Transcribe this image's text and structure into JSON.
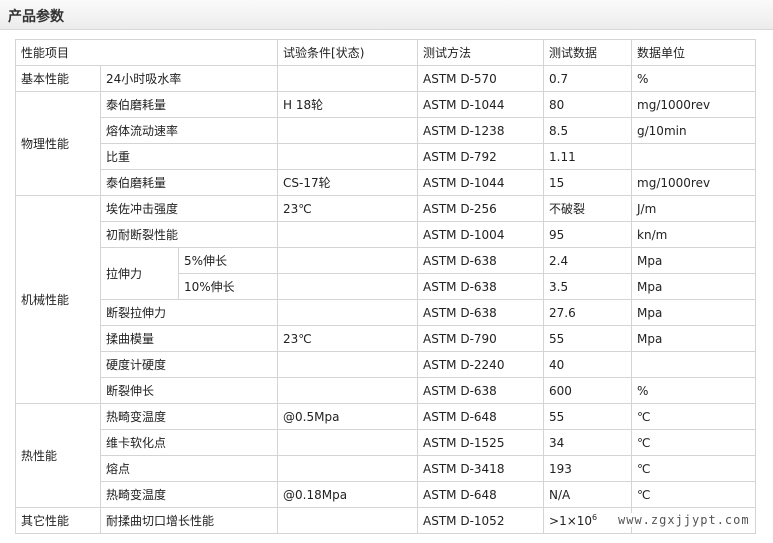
{
  "header": {
    "title": "产品参数"
  },
  "table": {
    "columns": [
      "性能项目",
      "试验条件[状态)",
      "测试方法",
      "测试数据",
      "数据单位"
    ],
    "rows": [
      {
        "category": "基本性能",
        "item": "24小时吸水率",
        "condition": "",
        "method": "ASTM D-570",
        "value": "0.7",
        "unit": "%"
      },
      {
        "category": "物理性能",
        "item": "泰伯磨耗量",
        "condition": "H 18轮",
        "method": "ASTM D-1044",
        "value": "80",
        "unit": "mg/1000rev"
      },
      {
        "category": "物理性能",
        "item": "熔体流动速率",
        "condition": "",
        "method": "ASTM D-1238",
        "value": "8.5",
        "unit": "g/10min"
      },
      {
        "category": "物理性能",
        "item": "比重",
        "condition": "",
        "method": "ASTM D-792",
        "value": "1.11",
        "unit": ""
      },
      {
        "category": "物理性能",
        "item": "泰伯磨耗量",
        "condition": "CS-17轮",
        "method": "ASTM D-1044",
        "value": "15",
        "unit": "mg/1000rev"
      },
      {
        "category": "机械性能",
        "item": "埃佐冲击强度",
        "condition": "23℃",
        "method": "ASTM D-256",
        "value": "不破裂",
        "unit": "J/m"
      },
      {
        "category": "机械性能",
        "item": "初耐断裂性能",
        "condition": "",
        "method": "ASTM D-1004",
        "value": "95",
        "unit": "kn/m"
      },
      {
        "category": "机械性能",
        "item": "拉伸力",
        "sub": "5%伸长",
        "condition": "",
        "method": "ASTM D-638",
        "value": "2.4",
        "unit": "Mpa"
      },
      {
        "category": "机械性能",
        "item": "拉伸力",
        "sub": "10%伸长",
        "condition": "",
        "method": "ASTM D-638",
        "value": "3.5",
        "unit": "Mpa"
      },
      {
        "category": "机械性能",
        "item": "断裂拉伸力",
        "condition": "",
        "method": "ASTM D-638",
        "value": "27.6",
        "unit": "Mpa"
      },
      {
        "category": "机械性能",
        "item": "揉曲模量",
        "condition": "23℃",
        "method": "ASTM D-790",
        "value": "55",
        "unit": "Mpa"
      },
      {
        "category": "机械性能",
        "item": "硬度计硬度",
        "condition": "",
        "method": "ASTM D-2240",
        "value": "40",
        "unit": ""
      },
      {
        "category": "机械性能",
        "item": "断裂伸长",
        "condition": "",
        "method": "ASTM D-638",
        "value": "600",
        "unit": "%"
      },
      {
        "category": "热性能",
        "item": "热畸变温度",
        "condition": "@0.5Mpa",
        "method": "ASTM D-648",
        "value": "55",
        "unit": "℃"
      },
      {
        "category": "热性能",
        "item": "维卡软化点",
        "condition": "",
        "method": "ASTM D-1525",
        "value": "34",
        "unit": "℃"
      },
      {
        "category": "热性能",
        "item": "熔点",
        "condition": "",
        "method": "ASTM D-3418",
        "value": "193",
        "unit": "℃"
      },
      {
        "category": "热性能",
        "item": "热畸变温度",
        "condition": "@0.18Mpa",
        "method": "ASTM D-648",
        "value": "N/A",
        "unit": "℃"
      },
      {
        "category": "其它性能",
        "item": "耐揉曲切口增长性能",
        "condition": "",
        "method": "ASTM D-1052",
        "value": ">1×10",
        "value_exp": "6",
        "unit": ""
      }
    ]
  },
  "watermark": "www.zgxjjypt.com"
}
